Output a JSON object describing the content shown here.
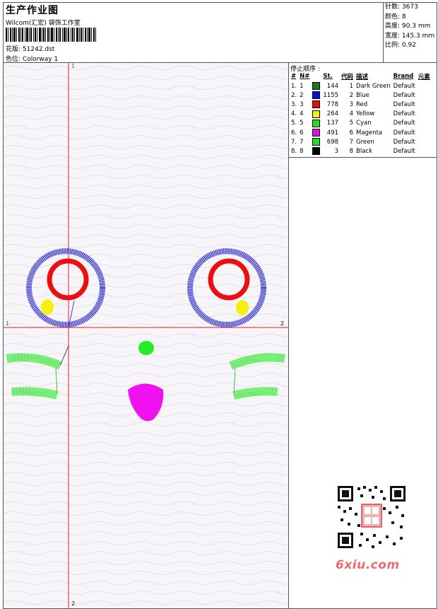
{
  "header": {
    "title": "生产作业图",
    "company": "Wilcom(汇宏) 袋饰工作室",
    "design_label": "花版:",
    "design_value": "51242.dst",
    "colorway_label": "色位:",
    "colorway_value": "Colorway 1"
  },
  "stats": [
    {
      "label": "针数",
      "value": "3673"
    },
    {
      "label": "颜色",
      "value": "8"
    },
    {
      "label": "高度",
      "value": "90.3 mm"
    },
    {
      "label": "宽度",
      "value": "145.3 mm"
    },
    {
      "label": "比例",
      "value": "0.92"
    }
  ],
  "stop_sequence": {
    "title": "停止顺序 :",
    "columns": [
      "#",
      "N#",
      "St.",
      "代码",
      "描述",
      "Brand",
      "元素"
    ],
    "rows": [
      {
        "seq": "1.",
        "n": "1",
        "color": "#1a7a1a",
        "st": "144",
        "code": "1",
        "desc": "Dark Green",
        "brand": "Default"
      },
      {
        "seq": "2.",
        "n": "2",
        "color": "#1010d0",
        "st": "1155",
        "code": "2",
        "desc": "Blue",
        "brand": "Default"
      },
      {
        "seq": "3.",
        "n": "3",
        "color": "#e01010",
        "st": "778",
        "code": "3",
        "desc": "Red",
        "brand": "Default"
      },
      {
        "seq": "4.",
        "n": "4",
        "color": "#f0f000",
        "st": "264",
        "code": "4",
        "desc": "Yellow",
        "brand": "Default"
      },
      {
        "seq": "5.",
        "n": "5",
        "color": "#22dd22",
        "st": "137",
        "code": "5",
        "desc": "Cyan",
        "brand": "Default"
      },
      {
        "seq": "6.",
        "n": "6",
        "color": "#e010e0",
        "st": "491",
        "code": "6",
        "desc": "Magenta",
        "brand": "Default"
      },
      {
        "seq": "7.",
        "n": "7",
        "color": "#22dd22",
        "st": "698",
        "code": "7",
        "desc": "Green",
        "brand": "Default"
      },
      {
        "seq": "8.",
        "n": "8",
        "color": "#000000",
        "st": "3",
        "code": "8",
        "desc": "Black",
        "brand": "Default"
      }
    ]
  },
  "guides": {
    "top": "1",
    "left": "1",
    "right": "2",
    "bottom": "2"
  },
  "watermark": "6xiu.com",
  "colors": {
    "guide": "#e02020",
    "blue": "#1818d8",
    "red": "#e81010",
    "yellow": "#f5f010",
    "green": "#22ee22",
    "magenta": "#f010f0"
  }
}
